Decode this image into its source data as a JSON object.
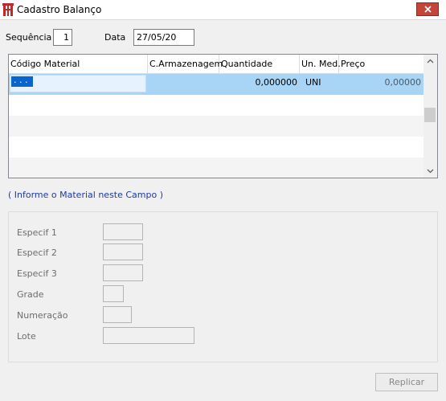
{
  "window": {
    "title": "Cadastro Balanço",
    "icon": "app-logo-icon",
    "close_icon": "close-icon",
    "close_color": "#c4463b"
  },
  "header": {
    "sequence_label": "Sequência",
    "sequence_value": "1",
    "date_label": "Data",
    "date_value": "27/05/20"
  },
  "grid": {
    "columns": [
      "Código Material",
      "C.Armazenagem",
      "Quantidade",
      "Un. Med.",
      "Preço"
    ],
    "rows": [
      {
        "codigo": ". . .",
        "armazenagem": "",
        "quantidade": "0,000000",
        "unidade": "UNI",
        "preco": "0,00000"
      }
    ],
    "selection_color": "#a8d4f5"
  },
  "hint": "( Informe o Material neste Campo )",
  "details": {
    "especif1_label": "Especif 1",
    "especif2_label": "Especif 2",
    "especif3_label": "Especif 3",
    "grade_label": "Grade",
    "numeracao_label": "Numeração",
    "lote_label": "Lote"
  },
  "footer": {
    "replicar_label": "Replicar"
  }
}
